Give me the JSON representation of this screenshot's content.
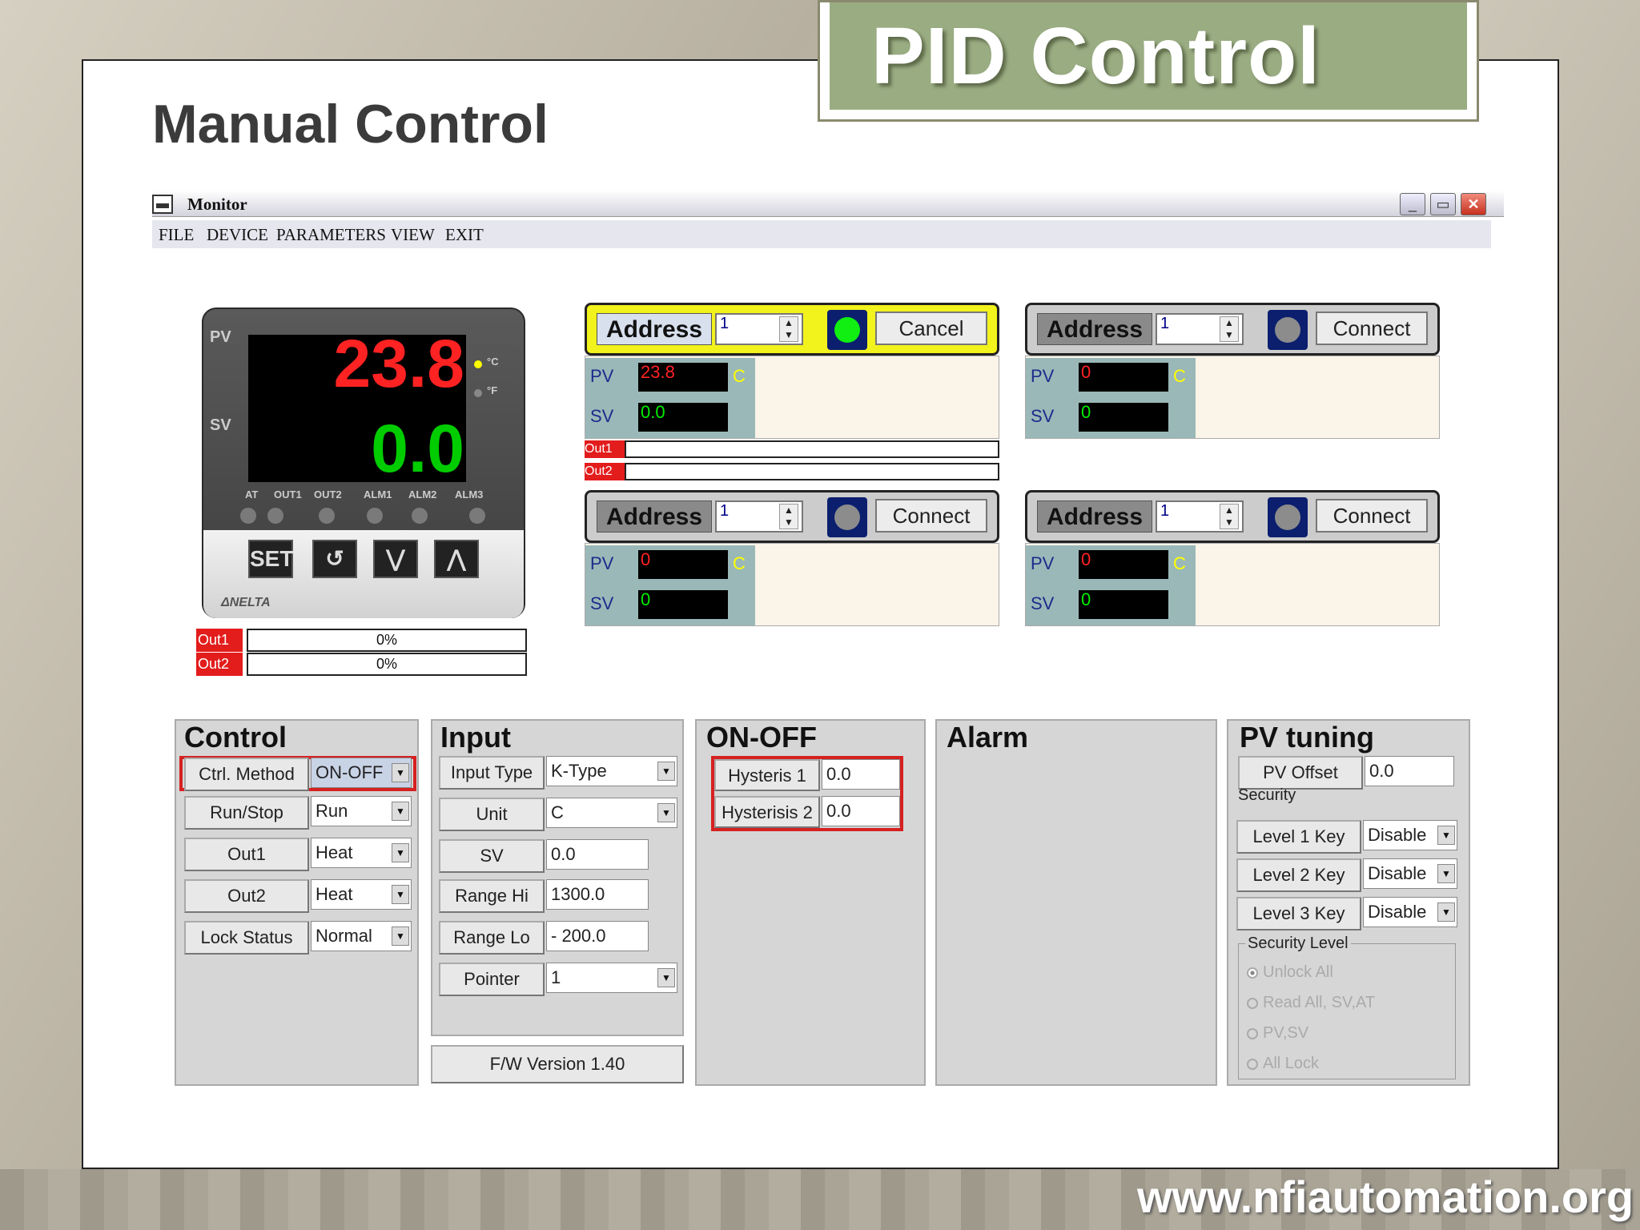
{
  "slide": {
    "title": "PID Control",
    "subtitle": "Manual Control",
    "footer_url": "www.nfiautomation.org"
  },
  "window": {
    "title": "Monitor",
    "menu": [
      "FILE",
      "DEVICE",
      "PARAMETERS",
      "VIEW",
      "EXIT"
    ],
    "buttons": [
      "_",
      "▭",
      "✕"
    ]
  },
  "device": {
    "pv_label": "PV",
    "sv_label": "SV",
    "pv_value": "23.8",
    "sv_value": "0.0",
    "unit_c": "°C",
    "unit_f": "°F",
    "indicators": [
      "AT",
      "OUT1",
      "OUT2",
      "ALM1",
      "ALM2",
      "ALM3"
    ],
    "keys": [
      "SET",
      "↺",
      "⋁",
      "⋀"
    ],
    "brand": "ΔNELTA",
    "out1_label": "Out1",
    "out2_label": "Out2",
    "out1_value": "0%",
    "out2_value": "0%"
  },
  "channels": [
    {
      "address_label": "Address",
      "address": "1",
      "button": "Cancel",
      "pv": "23.8",
      "sv": "0.0",
      "unit": "C",
      "connected": true,
      "out1": "Out1",
      "out2": "Out2"
    },
    {
      "address_label": "Address",
      "address": "1",
      "button": "Connect",
      "pv": "0",
      "sv": "0",
      "unit": "C",
      "connected": false
    },
    {
      "address_label": "Address",
      "address": "1",
      "button": "Connect",
      "pv": "0",
      "sv": "0",
      "unit": "C",
      "connected": false
    },
    {
      "address_label": "Address",
      "address": "1",
      "button": "Connect",
      "pv": "0",
      "sv": "0",
      "unit": "C",
      "connected": false
    }
  ],
  "pv_label": "PV",
  "sv_label": "SV",
  "control": {
    "title": "Control",
    "rows": [
      {
        "label": "Ctrl. Method",
        "value": "ON-OFF"
      },
      {
        "label": "Run/Stop",
        "value": "Run"
      },
      {
        "label": "Out1",
        "value": "Heat"
      },
      {
        "label": "Out2",
        "value": "Heat"
      },
      {
        "label": "Lock Status",
        "value": "Normal"
      }
    ]
  },
  "input": {
    "title": "Input",
    "rows": [
      {
        "label": "Input Type",
        "value": "K-Type",
        "dropdown": true
      },
      {
        "label": "Unit",
        "value": "C",
        "dropdown": true
      },
      {
        "label": "SV",
        "value": "0.0",
        "dropdown": false
      },
      {
        "label": "Range Hi",
        "value": "1300.0",
        "dropdown": false
      },
      {
        "label": "Range Lo",
        "value": "- 200.0",
        "dropdown": false
      },
      {
        "label": "Pointer",
        "value": "1",
        "dropdown": true
      }
    ],
    "fw_version": "F/W Version 1.40"
  },
  "onoff": {
    "title": "ON-OFF",
    "rows": [
      {
        "label": "Hysteris 1",
        "value": "0.0"
      },
      {
        "label": "Hysterisis 2",
        "value": "0.0"
      }
    ]
  },
  "alarm": {
    "title": "Alarm"
  },
  "pvtuning": {
    "title": "PV tuning",
    "offset_label": "PV Offset",
    "offset_value": "0.0",
    "security_label": "Security",
    "keys": [
      {
        "label": "Level 1 Key",
        "value": "Disable"
      },
      {
        "label": "Level 2 Key",
        "value": "Disable"
      },
      {
        "label": "Level 3 Key",
        "value": "Disable"
      }
    ],
    "level_label": "Security Level",
    "levels": [
      "Unlock All",
      "Read All, SV,AT",
      "PV,SV",
      "All Lock"
    ]
  },
  "colors": {
    "accent_title": "#9aac82",
    "alarm_red": "#e31c1c",
    "pv_red": "#ff2222",
    "sv_green": "#00cc00",
    "active_panel": "#f2f21c"
  }
}
